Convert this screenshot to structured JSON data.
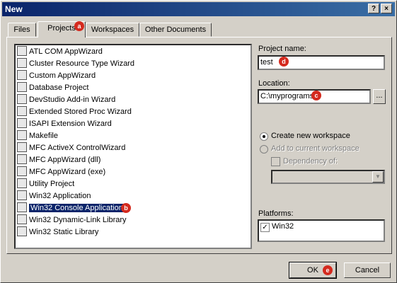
{
  "window": {
    "title": "New",
    "help_btn": "?",
    "close_btn": "×"
  },
  "tabs": [
    {
      "label": "Files"
    },
    {
      "label": "Projects"
    },
    {
      "label": "Workspaces"
    },
    {
      "label": "Other Documents"
    }
  ],
  "projects": [
    {
      "label": "ATL COM AppWizard"
    },
    {
      "label": "Cluster Resource Type Wizard"
    },
    {
      "label": "Custom AppWizard"
    },
    {
      "label": "Database Project"
    },
    {
      "label": "DevStudio Add-in Wizard"
    },
    {
      "label": "Extended Stored Proc Wizard"
    },
    {
      "label": "ISAPI Extension Wizard"
    },
    {
      "label": "Makefile"
    },
    {
      "label": "MFC ActiveX ControlWizard"
    },
    {
      "label": "MFC AppWizard (dll)"
    },
    {
      "label": "MFC AppWizard (exe)"
    },
    {
      "label": "Utility Project"
    },
    {
      "label": "Win32 Application"
    },
    {
      "label": "Win32 Console Application"
    },
    {
      "label": "Win32 Dynamic-Link Library"
    },
    {
      "label": "Win32 Static Library"
    }
  ],
  "selected_project": "Win32 Console Application",
  "project_name": {
    "label": "Project name:",
    "value": "test"
  },
  "location": {
    "label": "Location:",
    "value": "C:\\myprograms",
    "browse": "..."
  },
  "workspace": {
    "create_new": "Create new workspace",
    "add_current": "Add to current workspace",
    "dependency": "Dependency of:"
  },
  "platforms": {
    "label": "Platforms:",
    "items": [
      {
        "label": "Win32",
        "checked": true
      }
    ]
  },
  "buttons": {
    "ok": "OK",
    "cancel": "Cancel"
  },
  "annotations": {
    "a": "a",
    "b": "b",
    "c": "c",
    "d": "d",
    "e": "e"
  },
  "colors": {
    "title_bar": "#0a246a",
    "selection": "#0a246a",
    "badge": "#d42a1e",
    "face": "#d4d0c8"
  }
}
